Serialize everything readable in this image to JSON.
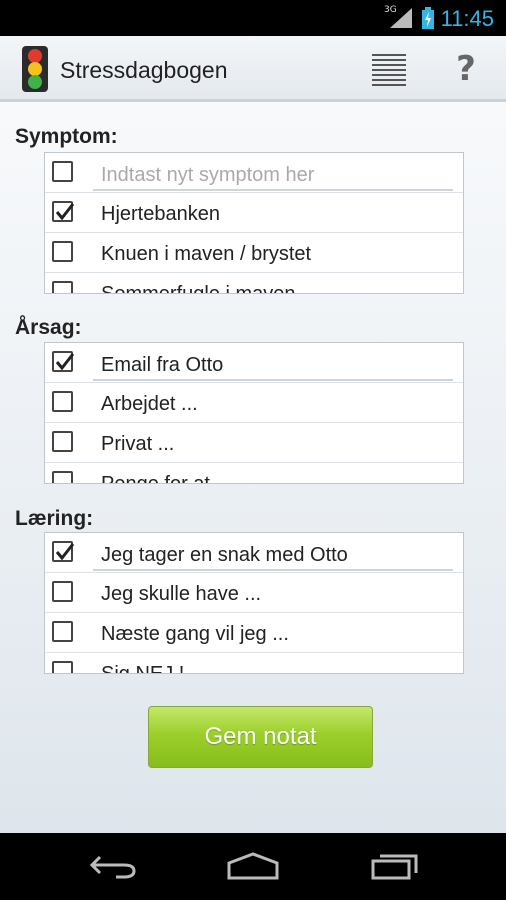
{
  "status_bar": {
    "time": "11:45",
    "network": "3G"
  },
  "app": {
    "title": "Stressdagbogen"
  },
  "sections": [
    {
      "label": "Symptom:",
      "input_placeholder": "Indtast nyt symptom her",
      "rows": [
        {
          "text": "Hjertebanken",
          "checked": true
        },
        {
          "text": "Knuen i maven / brystet",
          "checked": false
        },
        {
          "text": "Sommerfugle i maven",
          "checked": false
        }
      ]
    },
    {
      "label": "Årsag:",
      "input_value": "Email fra Otto",
      "input_checked": true,
      "rows": [
        {
          "text": "Arbejdet ...",
          "checked": false
        },
        {
          "text": "Privat ...",
          "checked": false
        },
        {
          "text": "Penge for at",
          "checked": false
        }
      ]
    },
    {
      "label": "Læring:",
      "input_value": "Jeg tager en snak med Otto",
      "input_checked": true,
      "rows": [
        {
          "text": "Jeg skulle have ...",
          "checked": false
        },
        {
          "text": "Næste gang vil jeg ...",
          "checked": false
        },
        {
          "text": "Sig NEJ !",
          "checked": false
        }
      ]
    }
  ],
  "save_button": {
    "label": "Gem notat"
  },
  "colors": {
    "accent_green": "#9ccf2b",
    "status_time": "#33b5e5"
  }
}
